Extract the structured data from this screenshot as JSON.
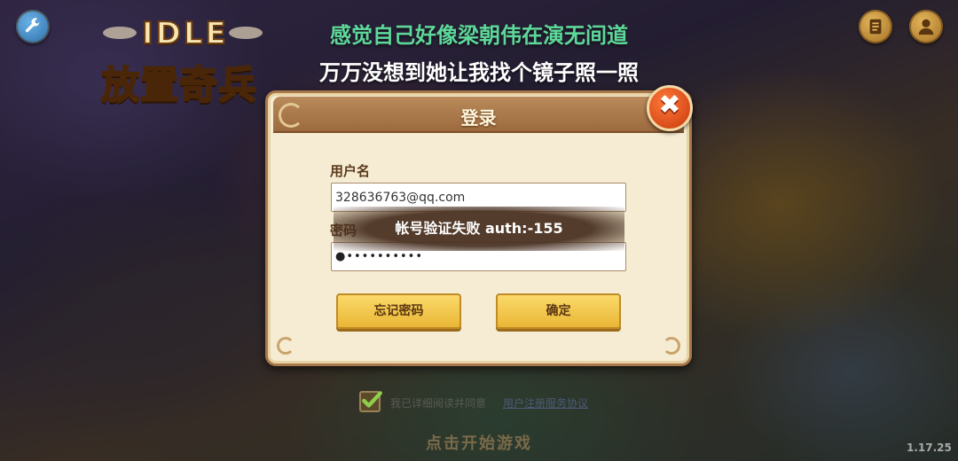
{
  "caption": {
    "line1": "感觉自己好像梁朝伟在演无间道",
    "line2": "万万没想到她让我找个镜子照一照"
  },
  "logo": {
    "top_text": "IDLE",
    "main_text": "放置奇兵"
  },
  "icons": {
    "settings": "wrench-icon",
    "notes": "notes-icon",
    "profile": "profile-icon",
    "close": "close-icon",
    "checkbox": "checkmark-icon"
  },
  "dialog": {
    "title": "登录",
    "close_label": "✖",
    "username_label": "用户名",
    "username_value": "328636763@qq.com",
    "password_label": "密码",
    "password_value": "●••••••••••",
    "forgot_button": "忘记密码",
    "confirm_button": "确定"
  },
  "toast": {
    "message": "帐号验证失败 auth:-155"
  },
  "agreement": {
    "text": "我已详细阅读并同意",
    "link": "用户注册服务协议",
    "checked": true
  },
  "start_prompt": "点击开始游戏",
  "version": "1.17.25",
  "colors": {
    "caption_green": "#5ed89a",
    "dialog_bg": "#f5ecd3",
    "header_brown": "#9c6a3e",
    "button_yellow": "#fbd96a",
    "close_red": "#c9380c"
  }
}
